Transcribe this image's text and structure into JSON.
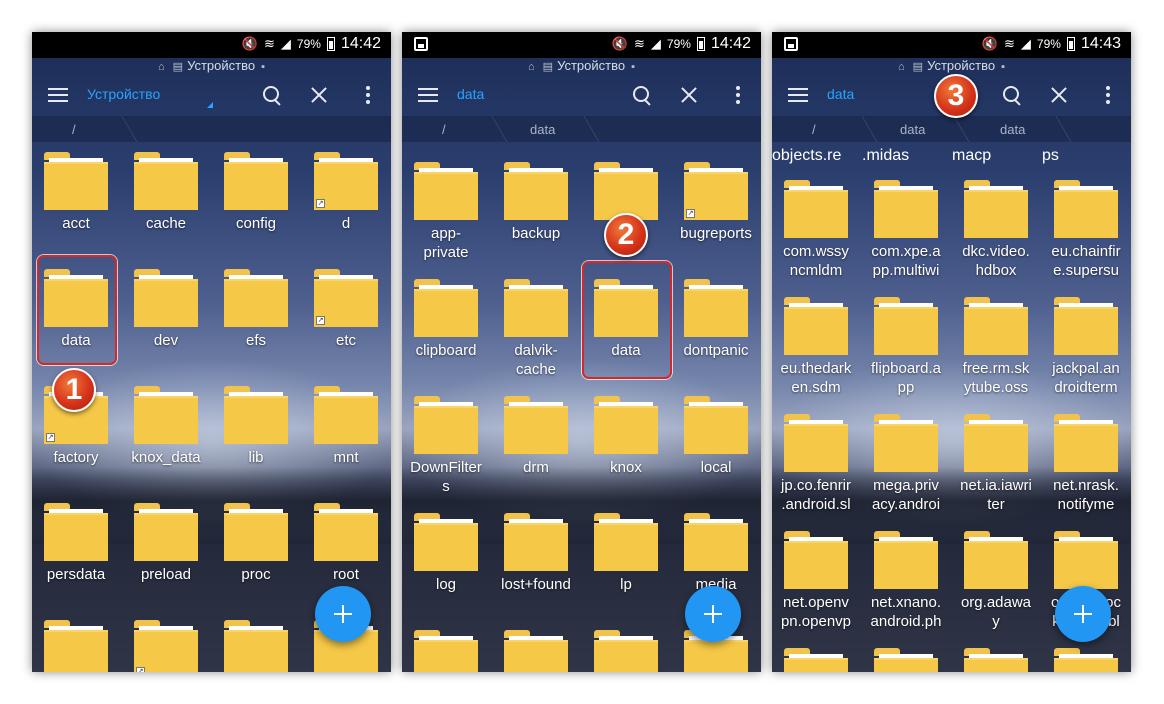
{
  "panels": [
    {
      "status": {
        "percent": "79%",
        "time": "14:42"
      },
      "storage_label": "Устройство",
      "toolbar_title": "Устройство",
      "path": [
        "/"
      ],
      "folders": [
        {
          "label": "acct"
        },
        {
          "label": "cache"
        },
        {
          "label": "config"
        },
        {
          "label": "d",
          "link": true
        },
        {
          "label": "data"
        },
        {
          "label": "dev"
        },
        {
          "label": "efs"
        },
        {
          "label": "etc",
          "link": true
        },
        {
          "label": "factory",
          "link": true
        },
        {
          "label": "knox_data"
        },
        {
          "label": "lib"
        },
        {
          "label": "mnt"
        },
        {
          "label": "persdata"
        },
        {
          "label": "preload"
        },
        {
          "label": "proc"
        },
        {
          "label": "root"
        },
        {
          "label": ""
        },
        {
          "label": ""
        },
        {
          "label": ""
        },
        {
          "label": ""
        }
      ],
      "step": "1"
    },
    {
      "status": {
        "percent": "79%",
        "time": "14:42"
      },
      "storage_label": "Устройство",
      "toolbar_title": "data",
      "path": [
        "/",
        "data"
      ],
      "folders": [
        {
          "label": "app-\nprivate"
        },
        {
          "label": "backup"
        },
        {
          "label": "b...s"
        },
        {
          "label": "bugreports",
          "link": true
        },
        {
          "label": "clipboard"
        },
        {
          "label": "dalvik-\ncache"
        },
        {
          "label": "data"
        },
        {
          "label": "dontpanic"
        },
        {
          "label": "DownFilter\ns"
        },
        {
          "label": "drm"
        },
        {
          "label": "knox"
        },
        {
          "label": "local"
        },
        {
          "label": "log"
        },
        {
          "label": "lost+found"
        },
        {
          "label": "lp"
        },
        {
          "label": "media"
        },
        {
          "label": ""
        },
        {
          "label": ""
        },
        {
          "label": ""
        },
        {
          "label": ""
        }
      ],
      "step": "2"
    },
    {
      "status": {
        "percent": "79%",
        "time": "14:43"
      },
      "storage_label": "Устройство",
      "toolbar_title": "data",
      "path": [
        "/",
        "data",
        "data"
      ],
      "top_labels": [
        "objects.re",
        ".midas",
        "macp",
        "ps"
      ],
      "folders": [
        {
          "label": "com.wssy\nncmldm"
        },
        {
          "label": "com.xpe.a\npp.multiwi"
        },
        {
          "label": "dkc.video.\nhdbox"
        },
        {
          "label": "eu.chainfir\ne.supersu"
        },
        {
          "label": "eu.thedark\nen.sdm"
        },
        {
          "label": "flipboard.a\npp"
        },
        {
          "label": "free.rm.sk\nytube.oss"
        },
        {
          "label": "jackpal.an\ndroidterm"
        },
        {
          "label": "jp.co.fenrir\n.android.sl"
        },
        {
          "label": "mega.priv\nacy.androi"
        },
        {
          "label": "net.ia.iawri\nter"
        },
        {
          "label": "net.nrask.\nnotifyme"
        },
        {
          "label": "net.openv\npn.openvp"
        },
        {
          "label": "net.xnano.\nandroid.ph"
        },
        {
          "label": "org.adawa\ny"
        },
        {
          "label": "org.adbloc\nkplus.adbl"
        },
        {
          "label": ""
        },
        {
          "label": ""
        },
        {
          "label": ""
        },
        {
          "label": ""
        }
      ],
      "step": "3"
    }
  ],
  "icons": {
    "menu": "menu-icon",
    "search": "search-icon",
    "close": "close-icon",
    "more": "more-vert-icon",
    "fab": "add-icon",
    "folder": "folder-icon"
  },
  "colors": {
    "folder": "#f6c847",
    "accent": "#29a3ff",
    "fab": "#2196f3",
    "highlight": "#d22a2a",
    "badge": "#d6341a"
  }
}
